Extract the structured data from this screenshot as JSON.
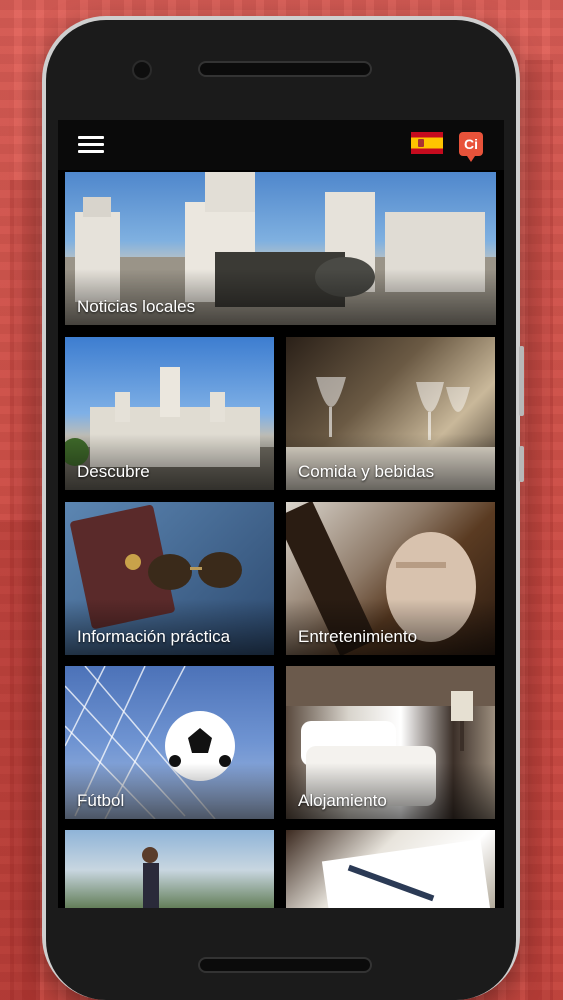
{
  "app": {
    "language_flag": "spain-flag-icon",
    "ci_button_label": "Ci",
    "menu_icon": "hamburger-menu-icon"
  },
  "tiles": [
    {
      "id": "noticias",
      "label": "Noticias locales"
    },
    {
      "id": "descubre",
      "label": "Descubre"
    },
    {
      "id": "comida",
      "label": "Comida y bebidas"
    },
    {
      "id": "info",
      "label": "Información práctica"
    },
    {
      "id": "entretenimiento",
      "label": "Entretenimiento"
    },
    {
      "id": "futbol",
      "label": "Fútbol"
    },
    {
      "id": "alojamiento",
      "label": "Alojamiento"
    },
    {
      "id": "bottom-left",
      "label": ""
    },
    {
      "id": "bottom-right",
      "label": ""
    }
  ],
  "colors": {
    "background": "#d8534a",
    "accent": "#e8533a",
    "screen_bg": "#000000"
  }
}
